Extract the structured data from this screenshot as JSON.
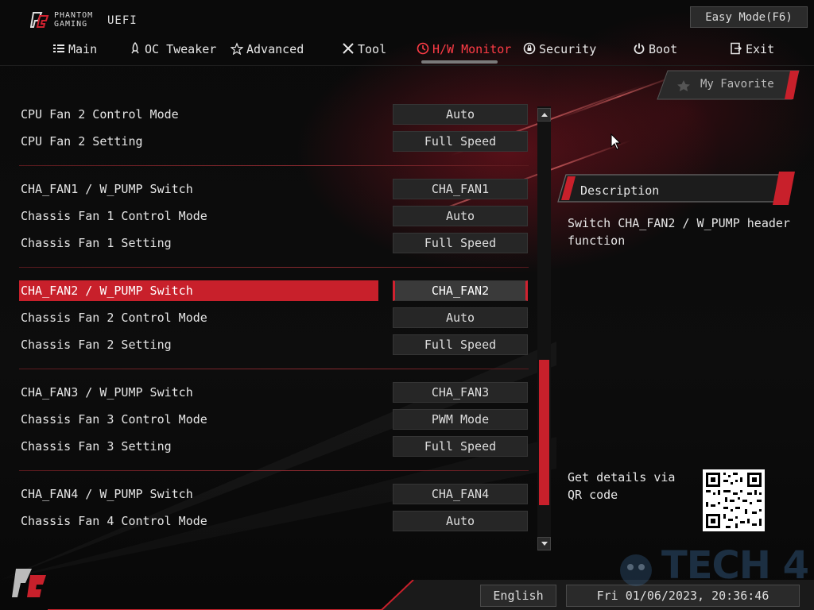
{
  "header": {
    "logo_line1": "PHANTOM",
    "logo_line2": "GAMING",
    "logo_uefi": "UEFI",
    "easy_mode_label": "Easy Mode(F6)"
  },
  "tabs": [
    {
      "label": "Main",
      "icon": "list-icon"
    },
    {
      "label": "OC Tweaker",
      "icon": "rocket-icon"
    },
    {
      "label": "Advanced",
      "icon": "star-icon"
    },
    {
      "label": "Tool",
      "icon": "tools-icon"
    },
    {
      "label": "H/W Monitor",
      "icon": "monitor-icon",
      "active": true
    },
    {
      "label": "Security",
      "icon": "shield-icon"
    },
    {
      "label": "Boot",
      "icon": "power-icon"
    },
    {
      "label": "Exit",
      "icon": "exit-icon"
    }
  ],
  "settings": [
    {
      "label": "CPU Fan 2 Control Mode",
      "value": "Auto"
    },
    {
      "label": "CPU Fan 2 Setting",
      "value": "Full Speed"
    },
    {
      "label": "CHA_FAN1 / W_PUMP Switch",
      "value": "CHA_FAN1"
    },
    {
      "label": "Chassis Fan 1 Control Mode",
      "value": "Auto"
    },
    {
      "label": "Chassis Fan 1 Setting",
      "value": "Full Speed"
    },
    {
      "label": "CHA_FAN2 / W_PUMP Switch",
      "value": "CHA_FAN2",
      "selected": true
    },
    {
      "label": "Chassis Fan 2 Control Mode",
      "value": "Auto"
    },
    {
      "label": "Chassis Fan 2 Setting",
      "value": "Full Speed"
    },
    {
      "label": "CHA_FAN3 / W_PUMP Switch",
      "value": "CHA_FAN3"
    },
    {
      "label": "Chassis Fan 3 Control Mode",
      "value": "PWM Mode"
    },
    {
      "label": "Chassis Fan 3 Setting",
      "value": "Full Speed"
    },
    {
      "label": "CHA_FAN4 / W_PUMP Switch",
      "value": "CHA_FAN4"
    },
    {
      "label": "Chassis Fan 4 Control Mode",
      "value": "Auto"
    }
  ],
  "right_panel": {
    "favorite_label": "My Favorite",
    "description_title": "Description",
    "description_text": "Switch CHA_FAN2 / W_PUMP header function",
    "qr_text": "Get details via QR code"
  },
  "footer": {
    "language": "English",
    "datetime": "Fri 01/06/2023, 20:36:46"
  },
  "watermark": "TECH 4",
  "colors": {
    "accent": "#c8202b",
    "active_tab": "#ff3c46",
    "background": "#050505"
  }
}
